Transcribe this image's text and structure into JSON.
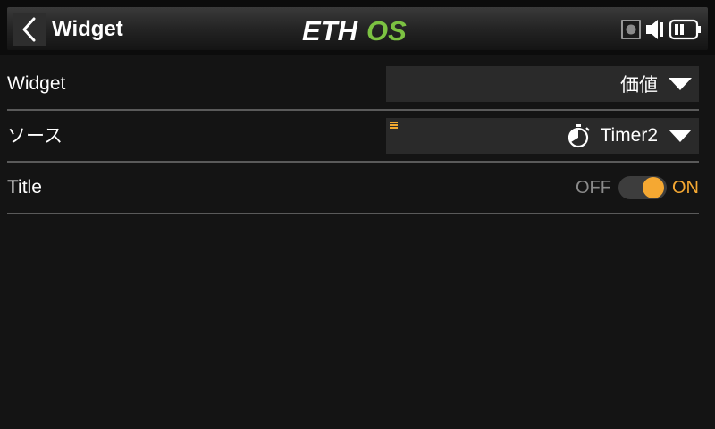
{
  "header": {
    "title": "Widget",
    "logo_left": "ETH",
    "logo_right": "OS",
    "back_icon": "chevron-left-icon",
    "status_icons": [
      "screen-record-icon",
      "volume-icon",
      "battery-icon"
    ]
  },
  "rows": [
    {
      "label": "Widget",
      "type": "dropdown",
      "value": "価値"
    },
    {
      "label": "ソース",
      "type": "dropdown",
      "icon": "stopwatch-icon",
      "value": "Timer2"
    },
    {
      "label": "Title",
      "type": "toggle",
      "off_label": "OFF",
      "on_label": "ON",
      "state": "on"
    }
  ],
  "colors": {
    "accent": "#f5a832",
    "logo_green": "#7cc242",
    "background": "#141414",
    "field_background": "#2a2a2a"
  }
}
